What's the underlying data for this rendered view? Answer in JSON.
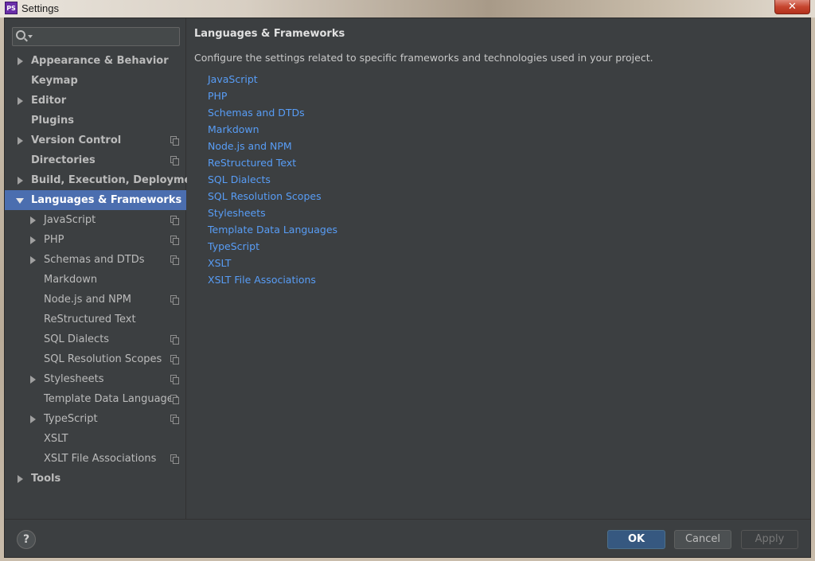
{
  "window": {
    "title": "Settings",
    "logo_text": "PS",
    "close_glyph": "✕"
  },
  "search": {
    "value": "",
    "placeholder": ""
  },
  "sidebar": {
    "items": [
      {
        "label": "Appearance & Behavior",
        "level": 0,
        "expandable": true,
        "expanded": false,
        "copy_icon": false
      },
      {
        "label": "Keymap",
        "level": 0,
        "expandable": false,
        "copy_icon": false
      },
      {
        "label": "Editor",
        "level": 0,
        "expandable": true,
        "expanded": false,
        "copy_icon": false
      },
      {
        "label": "Plugins",
        "level": 0,
        "expandable": false,
        "copy_icon": false
      },
      {
        "label": "Version Control",
        "level": 0,
        "expandable": true,
        "expanded": false,
        "copy_icon": true
      },
      {
        "label": "Directories",
        "level": 0,
        "expandable": false,
        "copy_icon": true
      },
      {
        "label": "Build, Execution, Deployment",
        "level": 0,
        "expandable": true,
        "expanded": false,
        "copy_icon": false
      },
      {
        "label": "Languages & Frameworks",
        "level": 0,
        "expandable": true,
        "expanded": true,
        "selected": true,
        "copy_icon": false
      },
      {
        "label": "JavaScript",
        "level": 1,
        "expandable": true,
        "expanded": false,
        "copy_icon": true
      },
      {
        "label": "PHP",
        "level": 1,
        "expandable": true,
        "expanded": false,
        "copy_icon": true
      },
      {
        "label": "Schemas and DTDs",
        "level": 1,
        "expandable": true,
        "expanded": false,
        "copy_icon": true
      },
      {
        "label": "Markdown",
        "level": 1,
        "expandable": false,
        "copy_icon": false
      },
      {
        "label": "Node.js and NPM",
        "level": 1,
        "expandable": false,
        "copy_icon": true
      },
      {
        "label": "ReStructured Text",
        "level": 1,
        "expandable": false,
        "copy_icon": false
      },
      {
        "label": "SQL Dialects",
        "level": 1,
        "expandable": false,
        "copy_icon": true
      },
      {
        "label": "SQL Resolution Scopes",
        "level": 1,
        "expandable": false,
        "copy_icon": true
      },
      {
        "label": "Stylesheets",
        "level": 1,
        "expandable": true,
        "expanded": false,
        "copy_icon": true
      },
      {
        "label": "Template Data Languages",
        "level": 1,
        "expandable": false,
        "copy_icon": true
      },
      {
        "label": "TypeScript",
        "level": 1,
        "expandable": true,
        "expanded": false,
        "copy_icon": true
      },
      {
        "label": "XSLT",
        "level": 1,
        "expandable": false,
        "copy_icon": false
      },
      {
        "label": "XSLT File Associations",
        "level": 1,
        "expandable": false,
        "copy_icon": true
      },
      {
        "label": "Tools",
        "level": 0,
        "expandable": true,
        "expanded": false,
        "copy_icon": false
      }
    ]
  },
  "content": {
    "title": "Languages & Frameworks",
    "description": "Configure the settings related to specific frameworks and technologies used in your project.",
    "links": [
      "JavaScript",
      "PHP",
      "Schemas and DTDs",
      "Markdown",
      "Node.js and NPM",
      "ReStructured Text",
      "SQL Dialects",
      "SQL Resolution Scopes",
      "Stylesheets",
      "Template Data Languages",
      "TypeScript",
      "XSLT",
      "XSLT File Associations"
    ]
  },
  "footer": {
    "help_label": "?",
    "ok_label": "OK",
    "cancel_label": "Cancel",
    "apply_label": "Apply"
  },
  "colors": {
    "background": "#3c3f41",
    "selection": "#4b6eaf",
    "link": "#589df6",
    "ok_button": "#365880"
  }
}
